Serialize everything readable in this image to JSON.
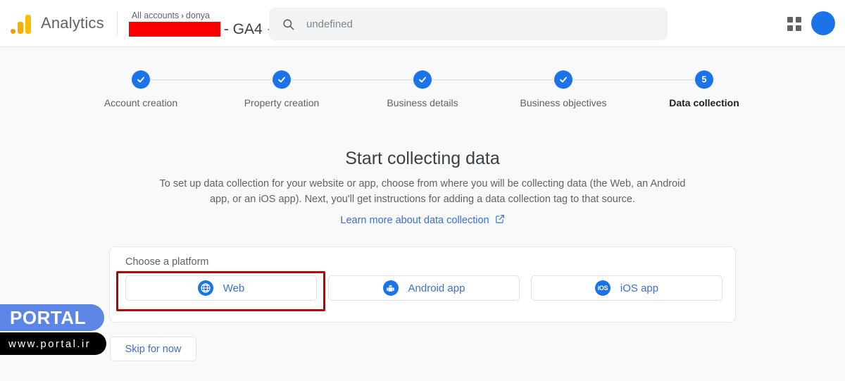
{
  "header": {
    "brand_name": "Analytics",
    "logo_icon": "google-analytics-logo",
    "breadcrumb_root": "All accounts",
    "breadcrumb_sep": "›",
    "breadcrumb_account": "donya",
    "property_redacted": "",
    "property_suffix": "- GA4",
    "caret_icon": "chevron-down-icon",
    "search": {
      "icon": "search-icon",
      "value": "",
      "placeholder": "undefined"
    },
    "apps_icon": "apps-grid-icon",
    "avatar": "user-avatar"
  },
  "stepper": {
    "steps": [
      {
        "label": "Account creation",
        "state": "complete",
        "marker": "check-icon"
      },
      {
        "label": "Property creation",
        "state": "complete",
        "marker": "check-icon"
      },
      {
        "label": "Business details",
        "state": "complete",
        "marker": "check-icon"
      },
      {
        "label": "Business objectives",
        "state": "complete",
        "marker": "check-icon"
      },
      {
        "label": "Data collection",
        "state": "active",
        "marker": "5"
      }
    ]
  },
  "main": {
    "heading": "Start collecting data",
    "description": "To set up data collection for your website or app, choose from where you will be collecting data (the Web, an Android app, or an iOS app). Next, you'll get instructions for adding a data collection tag to that source.",
    "learn_more_label": "Learn more about data collection",
    "learn_more_icon": "external-link-icon",
    "card_title": "Choose a platform",
    "platforms": [
      {
        "label": "Web",
        "icon": "globe-icon",
        "highlighted": true
      },
      {
        "label": "Android app",
        "icon": "android-icon",
        "highlighted": false
      },
      {
        "label": "iOS app",
        "icon": "ios-icon",
        "highlighted": false
      }
    ],
    "skip_label": "Skip for now"
  },
  "watermark": {
    "brand": "PORTAL",
    "url": "www.portal.ir"
  },
  "colors": {
    "accent_blue": "#1a73e8",
    "link_blue": "#3b6fd4",
    "highlight_red": "#c00000",
    "redaction_red": "#fb0000",
    "page_bg": "#f8f9fb",
    "watermark_blue": "#5b86e5"
  }
}
